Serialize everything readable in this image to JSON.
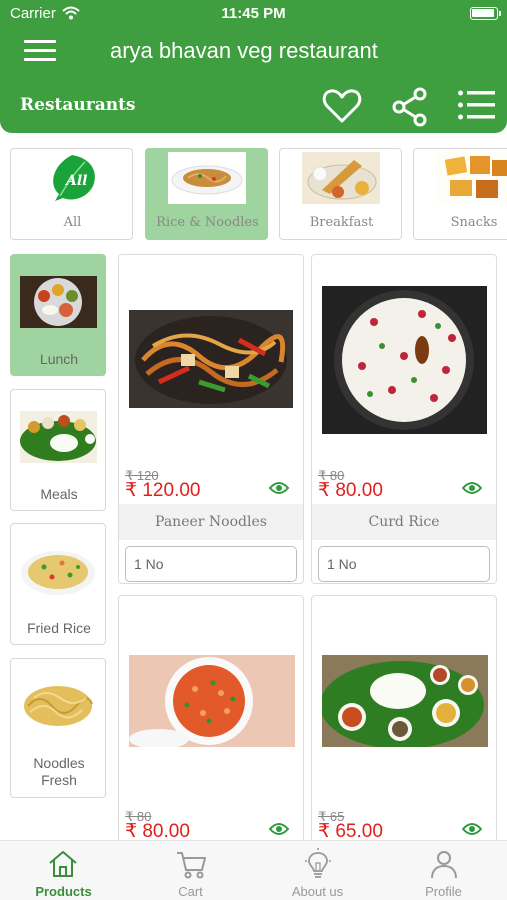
{
  "status_bar": {
    "carrier": "Carrier",
    "time": "11:45 PM"
  },
  "header": {
    "title": "arya bhavan veg restaurant",
    "section": "Restaurants"
  },
  "categories": [
    {
      "label": "All",
      "icon": "leaf-icon"
    },
    {
      "label": "Rice & Noodles",
      "icon": "noodles-plate-icon",
      "selected": true
    },
    {
      "label": "Breakfast",
      "icon": "dosa-plate-icon"
    },
    {
      "label": "Snacks",
      "icon": "snacks-plate-icon"
    }
  ],
  "subcategories": [
    {
      "label": "Lunch",
      "selected": true
    },
    {
      "label": "Meals"
    },
    {
      "label": "Fried Rice"
    },
    {
      "label": "Noodles Fresh"
    }
  ],
  "products": [
    {
      "name": "Paneer Noodles",
      "old_price": "₹ 120",
      "price": "₹  120.00",
      "qty": "1 No"
    },
    {
      "name": "Curd Rice",
      "old_price": "₹ 80",
      "price": "₹  80.00",
      "qty": "1 No"
    },
    {
      "name": "",
      "old_price": "₹ 80",
      "price": "₹  80.00"
    },
    {
      "name": "",
      "old_price": "₹ 65",
      "price": "₹  65.00"
    }
  ],
  "tabs": [
    {
      "label": "Products",
      "active": true
    },
    {
      "label": "Cart"
    },
    {
      "label": "About us"
    },
    {
      "label": "Profile"
    }
  ],
  "colors": {
    "brand_green": "#3f9e3f",
    "selected_green": "#9fd39f",
    "price_red": "#e0201a"
  }
}
